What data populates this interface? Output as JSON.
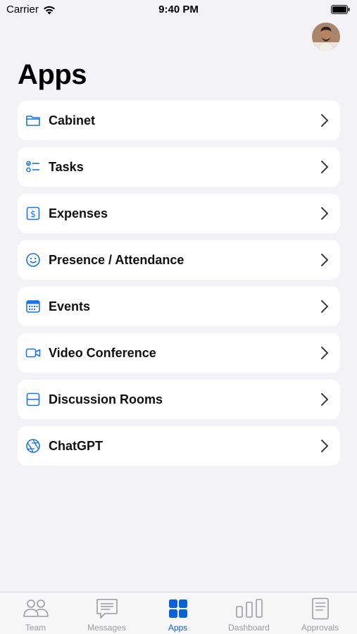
{
  "status_bar": {
    "carrier": "Carrier",
    "time": "9:40 PM"
  },
  "header": {
    "title": "Apps",
    "avatar_icon": "user-avatar"
  },
  "apps": [
    {
      "label": "Cabinet",
      "icon": "folder-icon"
    },
    {
      "label": "Tasks",
      "icon": "checklist-icon"
    },
    {
      "label": "Expenses",
      "icon": "dollar-icon"
    },
    {
      "label": "Presence / Attendance",
      "icon": "smiley-icon"
    },
    {
      "label": "Events",
      "icon": "calendar-icon"
    },
    {
      "label": "Video Conference",
      "icon": "video-icon"
    },
    {
      "label": "Discussion Rooms",
      "icon": "rooms-icon"
    },
    {
      "label": "ChatGPT",
      "icon": "aperture-icon"
    }
  ],
  "tab_bar": {
    "active": "Apps",
    "tabs": [
      {
        "label": "Team",
        "icon": "people-icon"
      },
      {
        "label": "Messages",
        "icon": "chat-icon"
      },
      {
        "label": "Apps",
        "icon": "grid-icon"
      },
      {
        "label": "Dashboard",
        "icon": "bar-chart-icon"
      },
      {
        "label": "Approvals",
        "icon": "document-icon"
      }
    ]
  },
  "colors": {
    "accent": "#0a62d8",
    "icon_blue": "#1a73e8",
    "background": "#f2f2f7",
    "inactive": "#9b9ba1"
  }
}
